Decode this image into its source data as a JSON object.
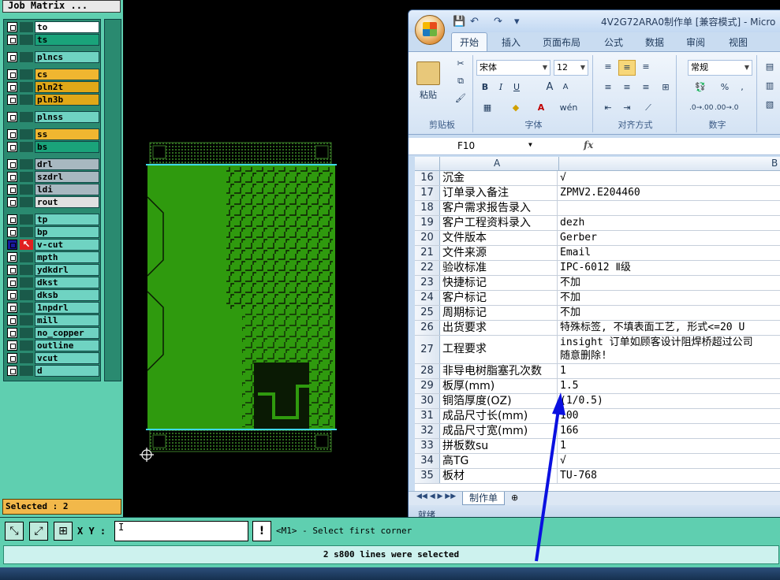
{
  "genesis": {
    "job_title": "Job Matrix ...",
    "layers": [
      {
        "name": "to",
        "color": "#ffffff",
        "selected": false
      },
      {
        "name": "ts",
        "color": "#1aa37a",
        "selected": false
      },
      {
        "name": "plncs",
        "color": "#6fd3c2",
        "selected": false
      },
      {
        "name": "cs",
        "color": "#f0b630",
        "selected": false
      },
      {
        "name": "pln2t",
        "color": "#e0a818",
        "selected": false
      },
      {
        "name": "pln3b",
        "color": "#e0a818",
        "selected": false
      },
      {
        "name": "plnss",
        "color": "#6fd3c2",
        "selected": false
      },
      {
        "name": "ss",
        "color": "#f0b630",
        "selected": false
      },
      {
        "name": "bs",
        "color": "#1aa37a",
        "selected": false
      },
      {
        "name": "drl",
        "color": "#a8b8c0",
        "selected": false
      },
      {
        "name": "szdrl",
        "color": "#a8b8c0",
        "selected": false
      },
      {
        "name": "ldi",
        "color": "#a8b8c0",
        "selected": false
      },
      {
        "name": "rout",
        "color": "#e0e0e0",
        "selected": false
      },
      {
        "name": "tp",
        "color": "#6fd3c2",
        "selected": false
      },
      {
        "name": "bp",
        "color": "#6fd3c2",
        "selected": false
      },
      {
        "name": "v-cut",
        "color": "#6fd3c2",
        "selected": true
      },
      {
        "name": "mpth",
        "color": "#6fd3c2",
        "selected": false
      },
      {
        "name": "ydkdrl",
        "color": "#6fd3c2",
        "selected": false
      },
      {
        "name": "dkst",
        "color": "#6fd3c2",
        "selected": false
      },
      {
        "name": "dksb",
        "color": "#6fd3c2",
        "selected": false
      },
      {
        "name": "1npdrl",
        "color": "#6fd3c2",
        "selected": false
      },
      {
        "name": "mill",
        "color": "#6fd3c2",
        "selected": false
      },
      {
        "name": "no_copper",
        "color": "#6fd3c2",
        "selected": false
      },
      {
        "name": "outline",
        "color": "#6fd3c2",
        "selected": false
      },
      {
        "name": "vcut",
        "color": "#6fd3c2",
        "selected": false
      },
      {
        "name": "d",
        "color": "#6fd3c2",
        "selected": false
      }
    ],
    "selected_label": "Selected : 2",
    "xy_label": "X Y :",
    "xy_value": "I",
    "warn_label": "!",
    "prompt": "<M1> - Select first corner",
    "status": "2 s800 lines were selected"
  },
  "excel": {
    "title": "4V2G72ARA0制作单  [兼容模式] - Micro",
    "tabs": [
      "开始",
      "插入",
      "页面布局",
      "公式",
      "数据",
      "审阅",
      "视图"
    ],
    "active_tab": "开始",
    "clipboard": {
      "paste": "粘贴",
      "label": "剪贴板"
    },
    "font": {
      "name": "宋体",
      "size": "12",
      "bold": "B",
      "italic": "I",
      "underline": "U",
      "grow": "A",
      "shrink": "A",
      "label": "字体"
    },
    "align": {
      "label": "对齐方式"
    },
    "number": {
      "format": "常规",
      "percent": "%",
      "comma": ",",
      "label": "数字"
    },
    "name_box": "F10",
    "fx": "fx",
    "col_a": "A",
    "col_b": "B",
    "rows": [
      {
        "num": "16",
        "a": "沉金",
        "b": "√"
      },
      {
        "num": "17",
        "a": "订单录入备注",
        "b": "ZPMV2.E204460"
      },
      {
        "num": "18",
        "a": "客户需求报告录入",
        "b": ""
      },
      {
        "num": "19",
        "a": "客户工程资料录入",
        "b": "dezh"
      },
      {
        "num": "20",
        "a": "文件版本",
        "b": "Gerber"
      },
      {
        "num": "21",
        "a": "文件来源",
        "b": "Email"
      },
      {
        "num": "22",
        "a": "验收标准",
        "b": "IPC-6012 Ⅱ级"
      },
      {
        "num": "23",
        "a": "快捷标记",
        "b": "不加"
      },
      {
        "num": "24",
        "a": "客户标记",
        "b": "不加"
      },
      {
        "num": "25",
        "a": "周期标记",
        "b": "不加"
      },
      {
        "num": "26",
        "a": "出货要求",
        "b": "特殊标签, 不填表面工艺,  形式<=20 U"
      },
      {
        "num": "27",
        "a": "工程要求",
        "b": "insight 订单如顾客设计阻焊桥超过公司",
        "b2": "随意删除!"
      },
      {
        "num": "28",
        "a": "非导电树脂塞孔次数",
        "b": "1"
      },
      {
        "num": "29",
        "a": "板厚(mm)",
        "b": "1.5"
      },
      {
        "num": "30",
        "a": "铜箔厚度(OZ)",
        "b": "(1/0.5)"
      },
      {
        "num": "31",
        "a": "成品尺寸长(mm)",
        "b": "100"
      },
      {
        "num": "32",
        "a": "成品尺寸宽(mm)",
        "b": "166"
      },
      {
        "num": "33",
        "a": "拼板数su",
        "b": "1"
      },
      {
        "num": "34",
        "a": "高TG",
        "b": "√"
      },
      {
        "num": "35",
        "a": "板材",
        "b": "TU-768"
      }
    ],
    "sheet_tab": "制作单",
    "status": "就绪"
  }
}
